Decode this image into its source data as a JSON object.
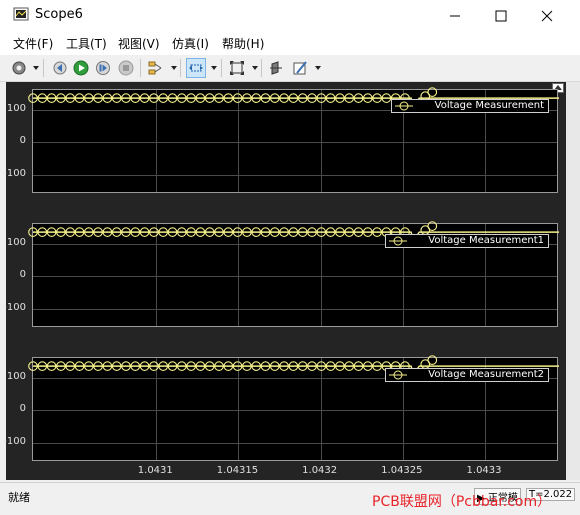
{
  "window": {
    "title": "Scope6",
    "minimize_icon": "minimize-icon",
    "maximize_icon": "maximize-icon",
    "close_icon": "close-icon"
  },
  "menu": [
    {
      "label": "文件(F)"
    },
    {
      "label": "工具(T)"
    },
    {
      "label": "视图(V)"
    },
    {
      "label": "仿真(I)"
    },
    {
      "label": "帮助(H)"
    }
  ],
  "toolbar": {
    "icons": [
      "settings-icon",
      "step-back-icon",
      "run-icon",
      "step-forward-icon",
      "stop-icon",
      "highlight-icon",
      "zoom-icon",
      "autoscale-icon",
      "cursor-icon",
      "style-icon"
    ]
  },
  "plots": [
    {
      "legend": "Voltage Measurement",
      "yticks": [
        "100",
        "0",
        "-100"
      ]
    },
    {
      "legend": "Voltage Measurement1",
      "yticks": [
        "100",
        "0",
        "-100"
      ]
    },
    {
      "legend": "Voltage Measurement2",
      "yticks": [
        "100",
        "0",
        "-100"
      ]
    }
  ],
  "xaxis": {
    "ticks": [
      "1.0431",
      "1.04315",
      "1.0432",
      "1.04325",
      "1.0433"
    ]
  },
  "chart_data": {
    "type": "line",
    "x_range": [
      1.043025,
      1.043345
    ],
    "y_range": [
      -160,
      160
    ],
    "series": [
      {
        "name": "Voltage Measurement",
        "x": [
          1.043025,
          1.043255,
          1.0432565,
          1.04326,
          1.043345
        ],
        "y": [
          135,
          135,
          110,
          135,
          135
        ]
      },
      {
        "name": "Voltage Measurement1",
        "x": [
          1.043025,
          1.043255,
          1.0432565,
          1.04326,
          1.043345
        ],
        "y": [
          135,
          135,
          110,
          135,
          135
        ]
      },
      {
        "name": "Voltage Measurement2",
        "x": [
          1.043025,
          1.043255,
          1.0432565,
          1.04326,
          1.043345
        ],
        "y": [
          135,
          135,
          110,
          135,
          135
        ]
      }
    ],
    "colors": {
      "line": "#f5f08a",
      "background": "#000000",
      "grid": "#4a4a4a"
    }
  },
  "status": {
    "left": "就绪",
    "mode": "▶ 正常模",
    "time": "T=2.022"
  },
  "watermark": "PCB联盟网（Pcbbar.com）"
}
